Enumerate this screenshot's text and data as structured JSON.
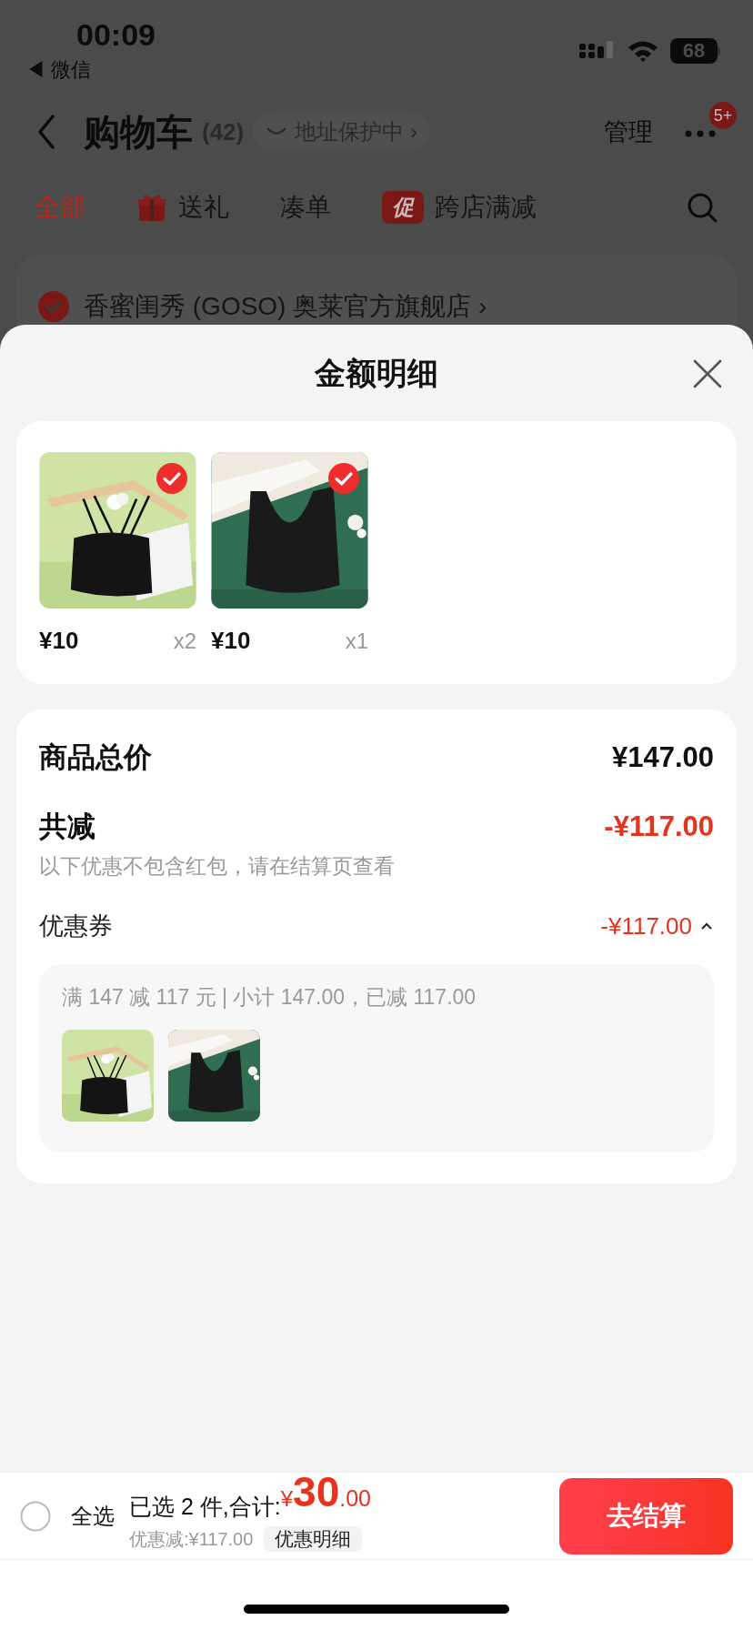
{
  "status_bar": {
    "time": "00:09",
    "back_app": "◀ 微信",
    "battery": "68"
  },
  "nav": {
    "title": "购物车",
    "count": "(42)",
    "address_badge": "地址保护中 ›",
    "manage": "管理",
    "more_badge": "5+"
  },
  "tabs": [
    {
      "label": "全部",
      "selected": true,
      "kind": "plain"
    },
    {
      "label": "送礼",
      "selected": false,
      "kind": "gift"
    },
    {
      "label": "凑单",
      "selected": false,
      "kind": "plain"
    },
    {
      "label": "跨店满减",
      "selected": false,
      "kind": "promo",
      "tag": "促"
    }
  ],
  "store": {
    "name": "香蜜闺秀 (GOSO) 奥莱官方旗舰店 ›",
    "checked": true
  },
  "sheet": {
    "title": "金额明细",
    "items": [
      {
        "price": "¥10",
        "quantity": "x2",
        "selected": true
      },
      {
        "price": "¥10",
        "quantity": "x1",
        "selected": true
      }
    ],
    "summary": {
      "total_label": "商品总价",
      "total": "¥147.00",
      "discount_label": "共减",
      "discount": "-¥117.00",
      "note": "以下优惠不包含红包，请在结算页查看",
      "coupon_label": "优惠券",
      "coupon": "-¥117.00",
      "coupon_expanded": true,
      "coupon_detail": "满 147 减 117 元 | 小计 147.00，已减 117.00"
    }
  },
  "bottom_bar": {
    "select_all": "全选",
    "all_checked": false,
    "selected_summary": "已选 2 件,合计:",
    "currency": "¥",
    "amount": "30",
    "decimals": ".00",
    "saving": "优惠减:¥117.00",
    "detail_button": "优惠明细",
    "checkout": "去结算"
  }
}
